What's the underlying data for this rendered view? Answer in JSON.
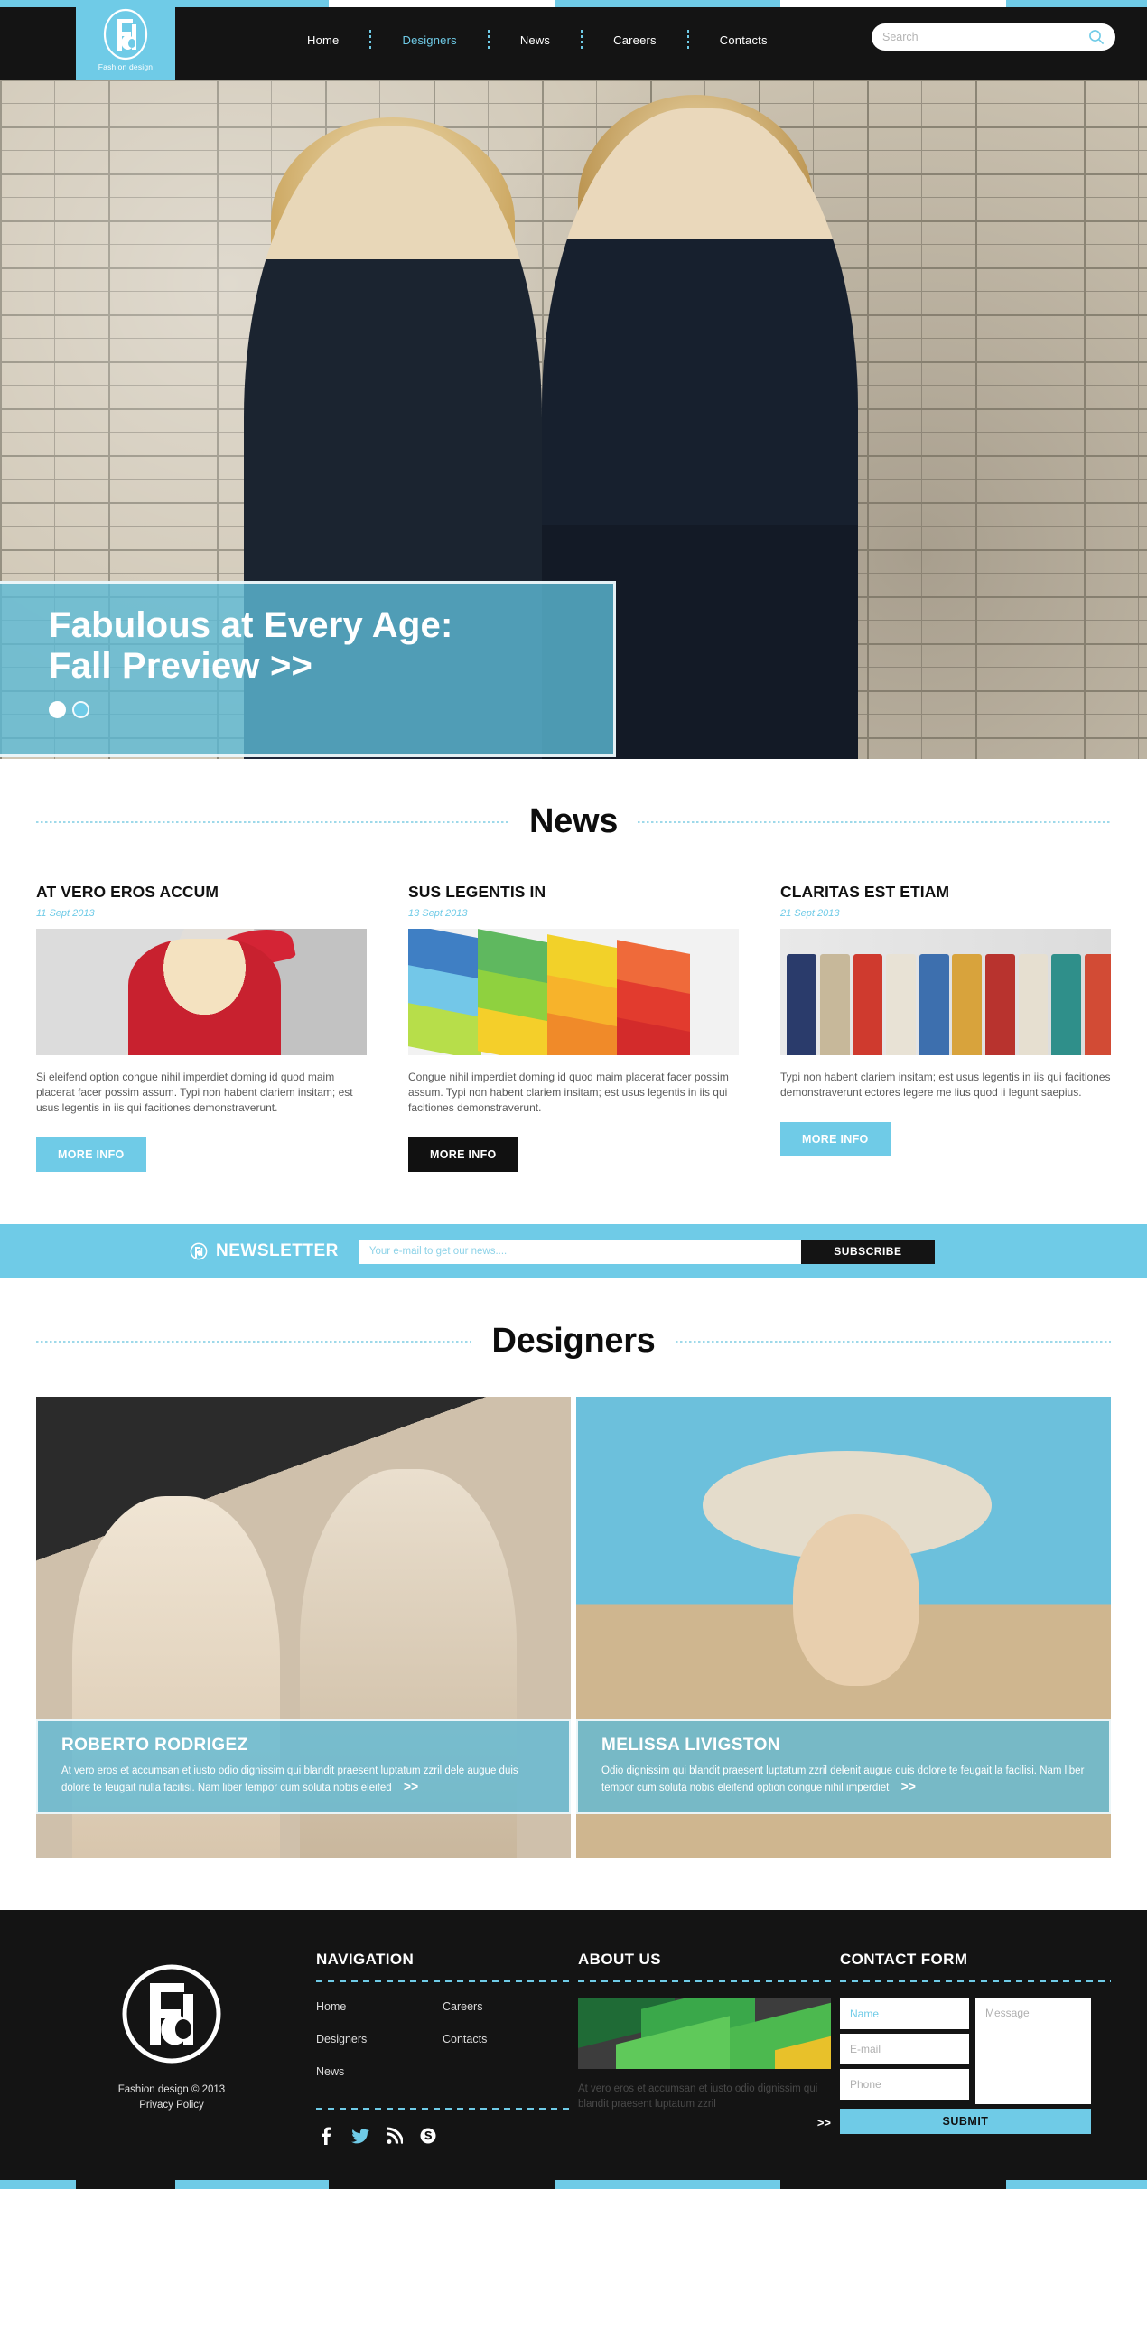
{
  "brand": {
    "logo_letters": "Fd",
    "sub": "Fashion design"
  },
  "nav": {
    "items": [
      {
        "label": "Home",
        "active": false
      },
      {
        "label": "Designers",
        "active": true
      },
      {
        "label": "News",
        "active": false
      },
      {
        "label": "Careers",
        "active": false
      },
      {
        "label": "Contacts",
        "active": false
      }
    ]
  },
  "search": {
    "placeholder": "Search",
    "value": "",
    "icon": "search-icon"
  },
  "hero": {
    "title_line1": "Fabulous at Every Age:",
    "title_line2": "Fall Preview >>",
    "slides": 2,
    "active_slide": 1
  },
  "news_section": {
    "title": "News",
    "items": [
      {
        "title": "AT VERO EROS ACCUM",
        "date": "11 Sept 2013",
        "text": "Si eleifend option congue nihil imperdiet doming id quod maim placerat facer possim assum. Typi non habent clariem insitam; est usus legentis in iis qui facitiones demonstraverunt.",
        "button": "MORE INFO",
        "button_style": "light"
      },
      {
        "title": "SUS LEGENTIS IN",
        "date": "13 Sept 2013",
        "text": "Congue nihil imperdiet doming id quod maim placerat facer possim assum. Typi non habent clariem insitam; est usus legentis in iis qui facitiones demonstraverunt.",
        "button": "MORE INFO",
        "button_style": "dark"
      },
      {
        "title": "CLARITAS EST ETIAM",
        "date": "21 Sept 2013",
        "text": "Typi non habent clariem insitam; est usus legentis in iis qui facitiones demonstraverunt ectores legere me lius quod ii legunt saepius.",
        "button": "MORE INFO",
        "button_style": "light"
      }
    ]
  },
  "newsletter": {
    "title": "NEWSLETTER",
    "placeholder": "Your e-mail to get our news....",
    "value": "",
    "button": "SUBSCRIBE"
  },
  "designers_section": {
    "title": "Designers",
    "items": [
      {
        "name": "ROBERTO RODRIGEZ",
        "text": "At vero eros et accumsan et iusto odio dignissim qui blandit praesent luptatum zzril dele augue duis dolore te feugait nulla facilisi. Nam liber tempor cum soluta nobis eleifed",
        "more": ">>"
      },
      {
        "name": "MELISSA LIVIGSTON",
        "text": "Odio dignissim qui blandit praesent luptatum zzril delenit augue duis dolore te feugait la facilisi. Nam liber tempor cum soluta nobis eleifend option congue nihil imperdiet",
        "more": ">>"
      }
    ]
  },
  "footer": {
    "copyright_line1": "Fashion design © 2013",
    "copyright_line2": "Privacy Policy",
    "navigation": {
      "heading": "NAVIGATION",
      "col1": [
        "Home",
        "Designers",
        "News"
      ],
      "col2": [
        "Careers",
        "Contacts"
      ],
      "socials": [
        "facebook-icon",
        "twitter-icon",
        "rss-icon",
        "skype-icon"
      ]
    },
    "about": {
      "heading": "ABOUT US",
      "text": "At vero eros et accumsan et iusto odio dignissim qui blandit praesent luptatum zzril",
      "more": ">>"
    },
    "contact": {
      "heading": "CONTACT FORM",
      "name_placeholder": "Name",
      "email_placeholder": "E-mail",
      "phone_placeholder": "Phone",
      "message_placeholder": "Message",
      "submit": "SUBMIT"
    }
  },
  "colors": {
    "accent": "#6fcbe7",
    "dark": "#141414",
    "white": "#ffffff"
  }
}
